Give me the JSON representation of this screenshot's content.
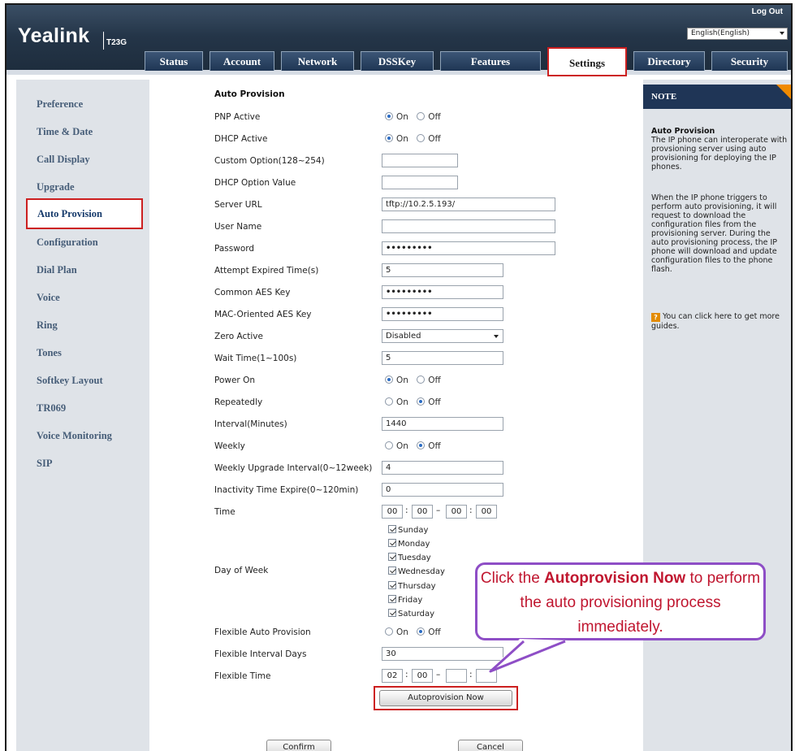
{
  "header": {
    "logo": "Yealink",
    "model": "T23G",
    "logout": "Log Out",
    "language": "English(English)"
  },
  "tabs": [
    "Status",
    "Account",
    "Network",
    "DSSKey",
    "Features",
    "Settings",
    "Directory",
    "Security"
  ],
  "active_tab": "Settings",
  "sidebar": {
    "items": [
      "Preference",
      "Time & Date",
      "Call Display",
      "Upgrade",
      "Auto Provision",
      "Configuration",
      "Dial Plan",
      "Voice",
      "Ring",
      "Tones",
      "Softkey Layout",
      "TR069",
      "Voice Monitoring",
      "SIP"
    ],
    "active": "Auto Provision"
  },
  "form": {
    "section_title": "Auto Provision",
    "pnp_active": {
      "label": "PNP Active",
      "on": "On",
      "off": "Off",
      "value": "On"
    },
    "dhcp_active": {
      "label": "DHCP Active",
      "on": "On",
      "off": "Off",
      "value": "On"
    },
    "custom_option": {
      "label": "Custom Option(128~254)",
      "value": ""
    },
    "dhcp_option_value": {
      "label": "DHCP Option Value",
      "value": ""
    },
    "server_url": {
      "label": "Server URL",
      "value": "tftp://10.2.5.193/"
    },
    "user_name": {
      "label": "User Name",
      "value": ""
    },
    "password": {
      "label": "Password",
      "value": "•••••••••"
    },
    "attempt_expired_time": {
      "label": "Attempt Expired Time(s)",
      "value": "5"
    },
    "common_aes_key": {
      "label": "Common AES Key",
      "value": "•••••••••"
    },
    "mac_aes_key": {
      "label": "MAC-Oriented AES Key",
      "value": "•••••••••"
    },
    "zero_active": {
      "label": "Zero Active",
      "value": "Disabled"
    },
    "wait_time": {
      "label": "Wait Time(1~100s)",
      "value": "5"
    },
    "power_on": {
      "label": "Power On",
      "on": "On",
      "off": "Off",
      "value": "On"
    },
    "repeatedly": {
      "label": "Repeatedly",
      "on": "On",
      "off": "Off",
      "value": "Off"
    },
    "interval": {
      "label": "Interval(Minutes)",
      "value": "1440"
    },
    "weekly": {
      "label": "Weekly",
      "on": "On",
      "off": "Off",
      "value": "Off"
    },
    "weekly_upgrade_interval": {
      "label": "Weekly Upgrade Interval(0~12week)",
      "value": "4"
    },
    "inactivity_time_expire": {
      "label": "Inactivity Time Expire(0~120min)",
      "value": "0"
    },
    "time": {
      "label": "Time",
      "h1": "00",
      "m1": "00",
      "h2": "00",
      "m2": "00",
      "colon": ":",
      "dash": "–"
    },
    "day_of_week": {
      "label": "Day of Week",
      "days": [
        "Sunday",
        "Monday",
        "Tuesday",
        "Wednesday",
        "Thursday",
        "Friday",
        "Saturday"
      ]
    },
    "flexible_auto_provision": {
      "label": "Flexible Auto Provision",
      "on": "On",
      "off": "Off",
      "value": "Off"
    },
    "flexible_interval_days": {
      "label": "Flexible Interval Days",
      "value": "30"
    },
    "flexible_time": {
      "label": "Flexible Time",
      "h1": "02",
      "m1": "00",
      "h2": "",
      "m2": ""
    },
    "autoprovision_button": "Autoprovision Now",
    "confirm_button": "Confirm",
    "cancel_button": "Cancel"
  },
  "note": {
    "header": "NOTE",
    "title": "Auto Provision",
    "p1": "The IP phone can interoperate with provsioning server using auto provisioning for deploying the IP phones.",
    "p2": "When the IP phone triggers to perform auto provisioning, it will request to download the configuration files from the provisioning server. During the auto provisioning process, the IP phone will download and update configuration files to the phone flash.",
    "guide_icon": "?",
    "guide": "You can click here to get more guides."
  },
  "callout": {
    "prefix": "Click the ",
    "bold": "Autoprovision Now",
    "suffix": " to perform the auto provisioning process immediately."
  },
  "colors": {
    "header_dark": "#243548",
    "highlight_red": "#cc1f1f",
    "callout_purple": "#8e4ec6",
    "callout_text": "#c0162f",
    "sidebar_text": "#465d78"
  }
}
